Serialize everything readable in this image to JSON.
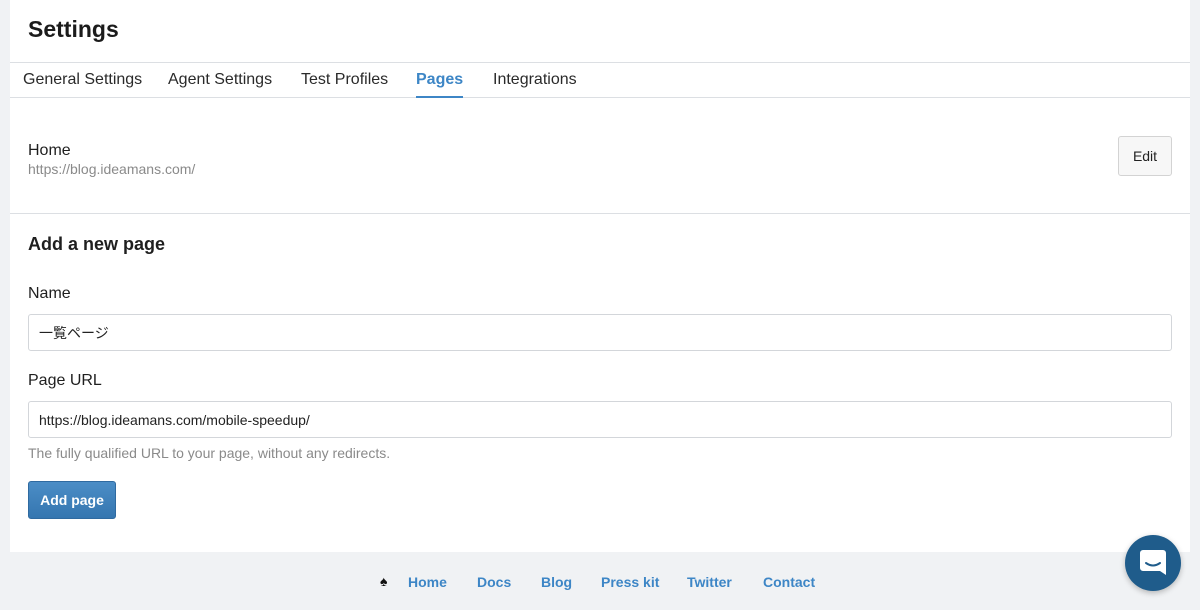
{
  "header": {
    "title": "Settings"
  },
  "tabs": [
    {
      "label": "General Settings",
      "active": false
    },
    {
      "label": "Agent Settings",
      "active": false
    },
    {
      "label": "Test Profiles",
      "active": false
    },
    {
      "label": "Pages",
      "active": true
    },
    {
      "label": "Integrations",
      "active": false
    }
  ],
  "existing_page": {
    "name": "Home",
    "url": "https://blog.ideamans.com/",
    "edit_label": "Edit"
  },
  "new_page": {
    "title": "Add a new page",
    "name_label": "Name",
    "name_value": "一覧ページ",
    "url_label": "Page URL",
    "url_value": "https://blog.ideamans.com/mobile-speedup/",
    "help": "The fully qualified URL to your page, without any redirects.",
    "submit_label": "Add page"
  },
  "footer": {
    "icon": "spade-icon",
    "links": [
      "Home",
      "Docs",
      "Blog",
      "Press kit",
      "Twitter",
      "Contact"
    ]
  },
  "chat": {
    "icon": "chat-bubble-icon"
  },
  "colors": {
    "accent": "#3d86c6",
    "primary_button": "#3576b0",
    "chat_launcher": "#1f5c8b",
    "page_background": "#f0f2f4"
  }
}
